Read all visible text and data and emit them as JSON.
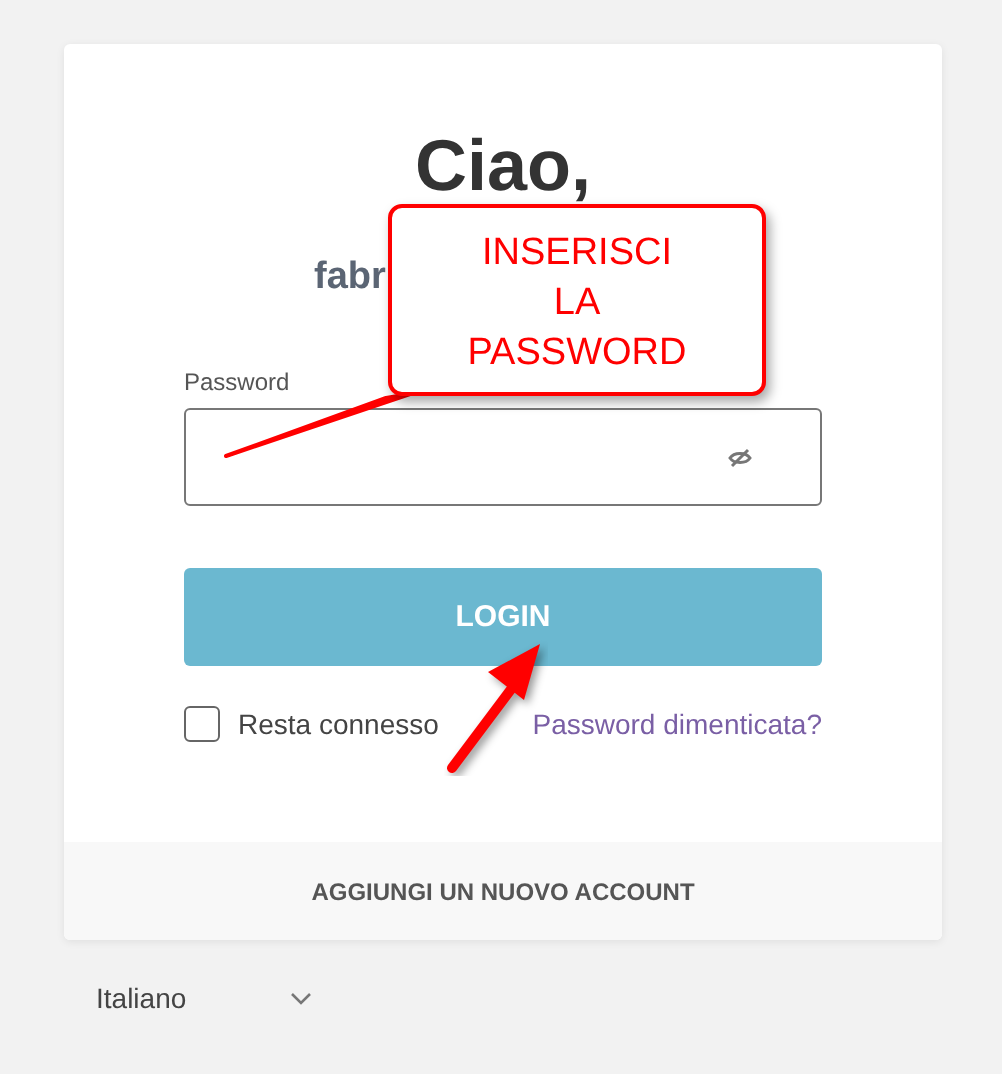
{
  "greeting": "Ciao,",
  "username": "fabr",
  "password_field": {
    "label": "Password",
    "password_hidden": true
  },
  "login_button": "LOGIN",
  "remember_me": {
    "label": "Resta connesso",
    "checked": false
  },
  "forgot_link": "Password dimenticata?",
  "add_account": "AGGIUNGI UN NUOVO ACCOUNT",
  "language": "Italiano",
  "callout": {
    "lines": [
      "INSERISCI",
      "LA",
      "PASSWORD"
    ]
  }
}
